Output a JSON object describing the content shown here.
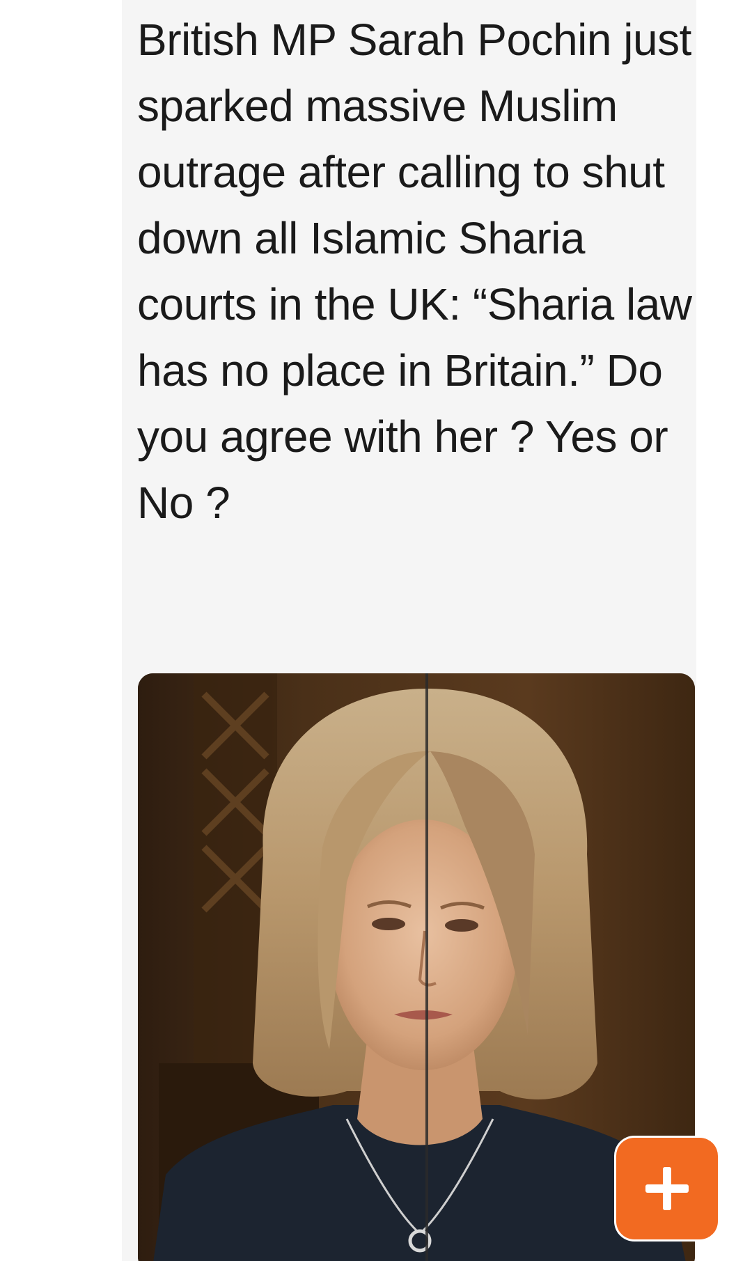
{
  "post": {
    "text": "British MP Sarah Pochin just sparked massive Muslim outrage after calling to shut down all Islamic Sharia courts in the UK: “Sharia law has no place in Britain.” Do you agree with her ? Yes or No ?"
  },
  "media": {
    "type": "photo"
  },
  "fab": {
    "icon": "plus-icon",
    "color": "#f26a21"
  }
}
